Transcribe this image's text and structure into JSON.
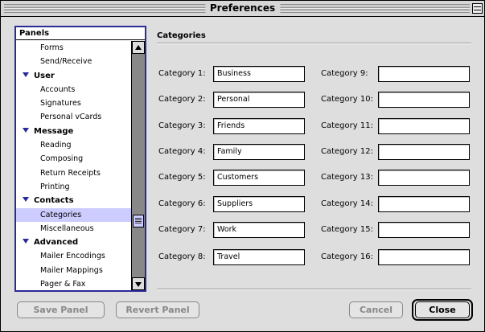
{
  "window": {
    "title": "Preferences"
  },
  "panels": {
    "header": "Panels",
    "items": [
      {
        "label": "Forms",
        "type": "item"
      },
      {
        "label": "Send/Receive",
        "type": "item"
      },
      {
        "label": "User",
        "type": "group"
      },
      {
        "label": "Accounts",
        "type": "item"
      },
      {
        "label": "Signatures",
        "type": "item"
      },
      {
        "label": "Personal vCards",
        "type": "item"
      },
      {
        "label": "Message",
        "type": "group"
      },
      {
        "label": "Reading",
        "type": "item"
      },
      {
        "label": "Composing",
        "type": "item"
      },
      {
        "label": "Return Receipts",
        "type": "item"
      },
      {
        "label": "Printing",
        "type": "item"
      },
      {
        "label": "Contacts",
        "type": "group"
      },
      {
        "label": "Categories",
        "type": "item",
        "selected": true
      },
      {
        "label": "Miscellaneous",
        "type": "item"
      },
      {
        "label": "Advanced",
        "type": "group"
      },
      {
        "label": "Mailer Encodings",
        "type": "item"
      },
      {
        "label": "Mailer Mappings",
        "type": "item"
      },
      {
        "label": "Pager & Fax",
        "type": "item"
      }
    ]
  },
  "section": {
    "title": "Categories"
  },
  "categories": [
    {
      "label": "Category 1:",
      "value": "Business"
    },
    {
      "label": "Category 2:",
      "value": "Personal"
    },
    {
      "label": "Category 3:",
      "value": "Friends"
    },
    {
      "label": "Category 4:",
      "value": "Family"
    },
    {
      "label": "Category 5:",
      "value": "Customers"
    },
    {
      "label": "Category 6:",
      "value": "Suppliers"
    },
    {
      "label": "Category 7:",
      "value": "Work"
    },
    {
      "label": "Category 8:",
      "value": "Travel"
    },
    {
      "label": "Category 9:",
      "value": ""
    },
    {
      "label": "Category 10:",
      "value": ""
    },
    {
      "label": "Category 11:",
      "value": ""
    },
    {
      "label": "Category 12:",
      "value": ""
    },
    {
      "label": "Category 13:",
      "value": ""
    },
    {
      "label": "Category 14:",
      "value": ""
    },
    {
      "label": "Category 15:",
      "value": ""
    },
    {
      "label": "Category 16:",
      "value": ""
    }
  ],
  "buttons": {
    "save_panel": "Save Panel",
    "revert_panel": "Revert Panel",
    "cancel": "Cancel",
    "close": "Close"
  },
  "colors": {
    "selection": "#ccccff",
    "focus_border": "#2a2a9a",
    "window_bg": "#dedede"
  }
}
